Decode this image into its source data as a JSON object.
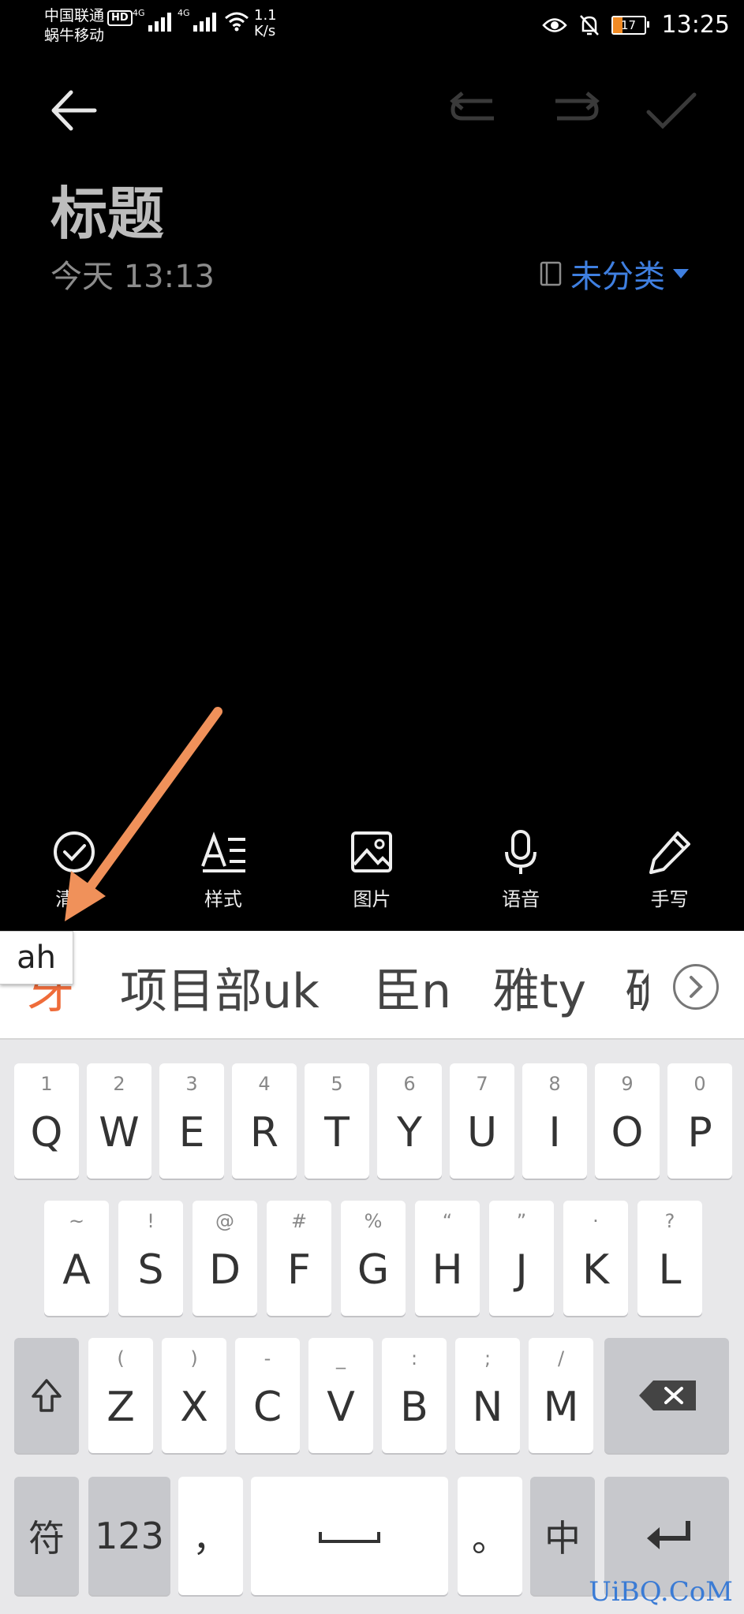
{
  "status_bar": {
    "carrier1": "中国联通",
    "hd": "HD",
    "carrier2": "蜗牛移动",
    "sig1_label": "4G",
    "sig2_label": "4G",
    "speed_value": "1.1",
    "speed_unit": "K/s",
    "battery": "17",
    "time": "13:25"
  },
  "note": {
    "title": "标题",
    "date": "今天 13:13",
    "category": "未分类"
  },
  "toolbar": {
    "items": [
      {
        "label": "清单",
        "icon": "checklist-icon"
      },
      {
        "label": "样式",
        "icon": "text-style-icon"
      },
      {
        "label": "图片",
        "icon": "image-icon"
      },
      {
        "label": "语音",
        "icon": "microphone-icon"
      },
      {
        "label": "手写",
        "icon": "handwriting-icon"
      }
    ]
  },
  "ime": {
    "pinyin": "ah",
    "candidates": [
      "牙",
      "项目部uk",
      "臣n",
      "雅ty",
      "确"
    ]
  },
  "keyboard": {
    "row1": [
      {
        "main": "Q",
        "sub": "1"
      },
      {
        "main": "W",
        "sub": "2"
      },
      {
        "main": "E",
        "sub": "3"
      },
      {
        "main": "R",
        "sub": "4"
      },
      {
        "main": "T",
        "sub": "5"
      },
      {
        "main": "Y",
        "sub": "6"
      },
      {
        "main": "U",
        "sub": "7"
      },
      {
        "main": "I",
        "sub": "8"
      },
      {
        "main": "O",
        "sub": "9"
      },
      {
        "main": "P",
        "sub": "0"
      }
    ],
    "row2": [
      {
        "main": "A",
        "sub": "~"
      },
      {
        "main": "S",
        "sub": "!"
      },
      {
        "main": "D",
        "sub": "@"
      },
      {
        "main": "F",
        "sub": "#"
      },
      {
        "main": "G",
        "sub": "%"
      },
      {
        "main": "H",
        "sub": "“"
      },
      {
        "main": "J",
        "sub": "”"
      },
      {
        "main": "K",
        "sub": "·"
      },
      {
        "main": "L",
        "sub": "?"
      }
    ],
    "row3": [
      {
        "main": "Z",
        "sub": "("
      },
      {
        "main": "X",
        "sub": ")"
      },
      {
        "main": "C",
        "sub": "-"
      },
      {
        "main": "V",
        "sub": "_"
      },
      {
        "main": "B",
        "sub": ":"
      },
      {
        "main": "N",
        "sub": ";"
      },
      {
        "main": "M",
        "sub": "/"
      }
    ],
    "symbols_label": "符",
    "numbers_label": "123",
    "comma_label": "，",
    "period_label": "。",
    "lang_label": "中"
  },
  "watermark": "UiBQ.CoM",
  "colors": {
    "accent_blue": "#3f7fe0",
    "candidate_orange": "#ef6c3a",
    "arrow_orange": "#f0915a"
  }
}
